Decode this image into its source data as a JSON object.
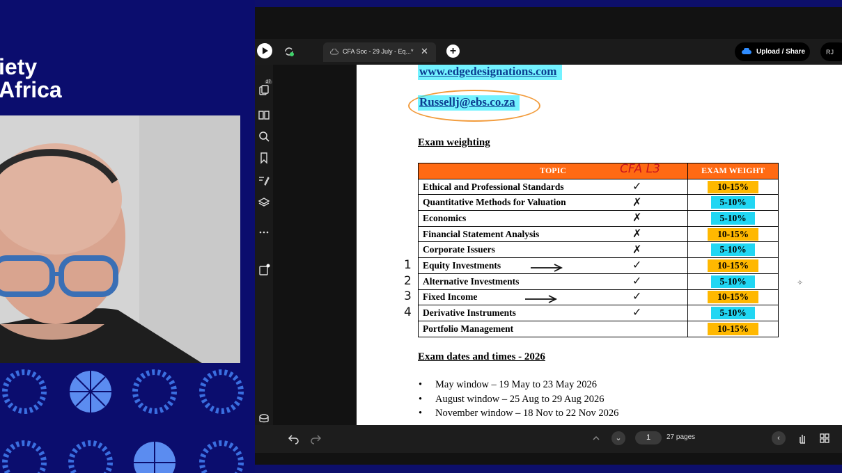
{
  "brand": {
    "line1": "iety",
    "line2": "Africa"
  },
  "viewer": {
    "tab_title": "CFA Soc - 29 July - Eq...*",
    "tab_close": "✕",
    "new_tab": "+",
    "upload_label": "Upload / Share",
    "avatar_initials": "RJ",
    "rail_badge_top": "27",
    "page_current": "1",
    "page_count_label": "27 pages"
  },
  "document": {
    "website": "www.edgedesignations.com",
    "email": "Russellj@ebs.co.za",
    "weighting_heading": "Exam weighting",
    "table": {
      "header_topic": "TOPIC",
      "header_weight": "EXAM WEIGHT",
      "annotation_header": "CFA L3",
      "rows": [
        {
          "topic": "Ethical and Professional Standards",
          "weight": "10-15%",
          "mark": "✓",
          "num": ""
        },
        {
          "topic": "Quantitative Methods for Valuation",
          "weight": "5-10%",
          "mark": "✗",
          "num": ""
        },
        {
          "topic": "Economics",
          "weight": "5-10%",
          "mark": "✗",
          "num": ""
        },
        {
          "topic": "Financial Statement Analysis",
          "weight": "10-15%",
          "mark": "✗",
          "num": ""
        },
        {
          "topic": "Corporate Issuers",
          "weight": "5-10%",
          "mark": "✗",
          "num": ""
        },
        {
          "topic": "Equity Investments",
          "weight": "10-15%",
          "mark": "✓",
          "num": "1"
        },
        {
          "topic": "Alternative Investments",
          "weight": "5-10%",
          "mark": "✓",
          "num": "2"
        },
        {
          "topic": "Fixed Income",
          "weight": "10-15%",
          "mark": "✓",
          "num": "3"
        },
        {
          "topic": "Derivative Instruments",
          "weight": "5-10%",
          "mark": "✓",
          "num": "4"
        },
        {
          "topic": "Portfolio Management",
          "weight": "10-15%",
          "mark": "",
          "num": ""
        }
      ]
    },
    "dates_heading": "Exam dates and times - 2026",
    "dates": [
      "May window – 19 May to 23 May 2026",
      "August window – 25 Aug to 29 Aug 2026",
      "November window – 18 Nov to 22 Nov 2026"
    ]
  },
  "colors": {
    "brand_bg": "#0b0d6e",
    "table_header": "#ff6a13",
    "highlight_yellow": "#ffb800",
    "highlight_cyan": "#21d6f3",
    "link": "#0b3d91"
  }
}
